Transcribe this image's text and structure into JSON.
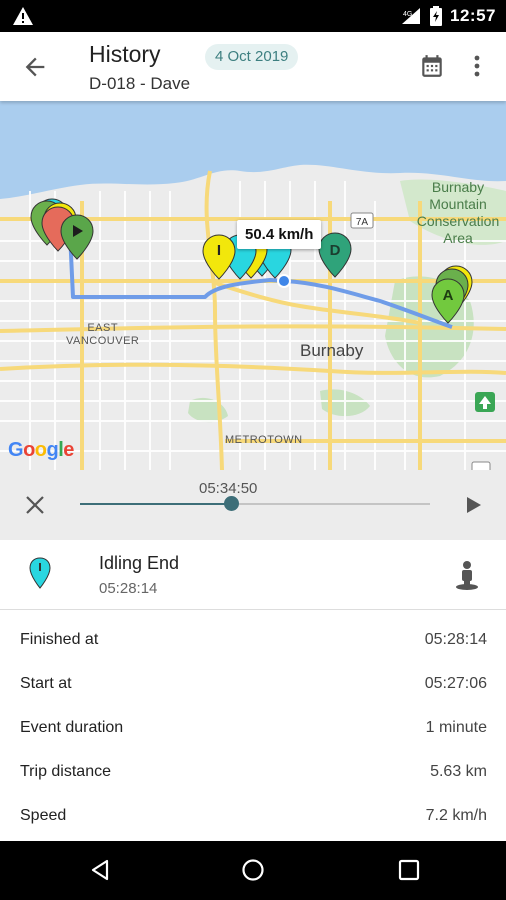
{
  "status_bar": {
    "time": "12:57",
    "network": "4G"
  },
  "app_bar": {
    "title": "History",
    "subtitle": "D-018 - Dave",
    "date": "4 Oct 2019"
  },
  "map": {
    "speed_label": "50.4 km/h",
    "labels": {
      "east_vancouver": "EAST\nVANCOUVER",
      "burnaby": "Burnaby",
      "metrotown": "METROTOWN",
      "park": "Burnaby\nMountain\nConservation\nArea",
      "highway": "7A"
    },
    "google_logo": "Google",
    "marker_letters": {
      "idle": "I",
      "end": "D",
      "arrive": "A"
    },
    "route_color": "#6f9ce8"
  },
  "player": {
    "timecode": "05:34:50",
    "progress_fraction": 0.43
  },
  "event": {
    "title": "Idling End",
    "time": "05:28:14",
    "pin_color": "#29d6e0"
  },
  "details": [
    {
      "label": "Finished at",
      "value": "05:28:14"
    },
    {
      "label": "Start at",
      "value": "05:27:06"
    },
    {
      "label": "Event duration",
      "value": "1 minute"
    },
    {
      "label": "Trip distance",
      "value": "5.63 km"
    },
    {
      "label": "Speed",
      "value": "7.2 km/h"
    }
  ],
  "icons": {
    "back": "arrow-left-icon",
    "calendar": "calendar-icon",
    "more": "more-vert-icon",
    "close": "close-icon",
    "play": "play-icon",
    "person": "person-pin-icon",
    "nav_back": "nav-back-icon",
    "nav_home": "nav-home-icon",
    "nav_recents": "nav-recents-icon"
  }
}
